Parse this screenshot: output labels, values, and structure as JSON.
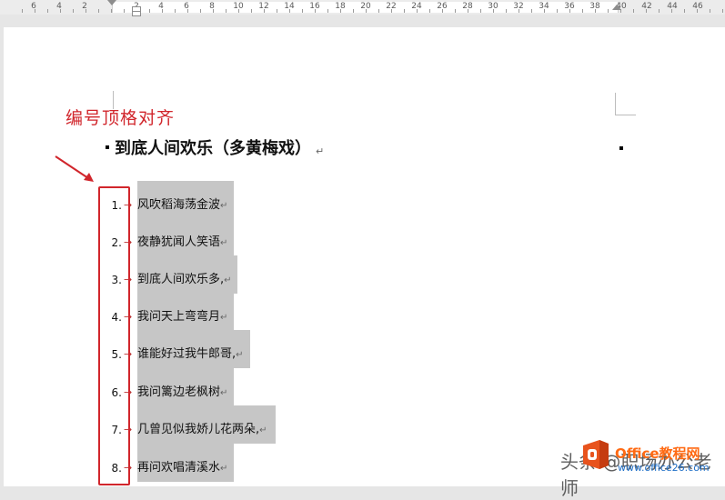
{
  "ruler": {
    "labels": [
      "6",
      "4",
      "2",
      "2",
      "4",
      "6",
      "8",
      "10",
      "12",
      "14",
      "16",
      "18",
      "20",
      "22",
      "24",
      "26",
      "28",
      "30",
      "32",
      "34",
      "36",
      "38",
      "40",
      "42",
      "44",
      "46"
    ]
  },
  "annotation": "编号顶格对齐",
  "heading": "到底人间欢乐（多黄梅戏）",
  "paragraph_mark": "↵",
  "list": [
    {
      "num": "1.",
      "text": "风吹稻海荡金波"
    },
    {
      "num": "2.",
      "text": "夜静犹闻人笑语"
    },
    {
      "num": "3.",
      "text": "到底人间欢乐多,"
    },
    {
      "num": "4.",
      "text": "我问天上弯弯月"
    },
    {
      "num": "5.",
      "text": "谁能好过我牛郎哥,"
    },
    {
      "num": "6.",
      "text": "我问篱边老枫树"
    },
    {
      "num": "7.",
      "text": "几曾见似我娇儿花两朵,"
    },
    {
      "num": "8.",
      "text": "再问欢唱清溪水"
    }
  ],
  "watermark": {
    "text": "头条 @职场办公老师",
    "brand": "Office教程网",
    "url": "www.office26.com"
  },
  "colors": {
    "annotation_red": "#d1262c",
    "highlight_gray": "#c6c6c6",
    "brand_orange": "#ff6a13"
  }
}
